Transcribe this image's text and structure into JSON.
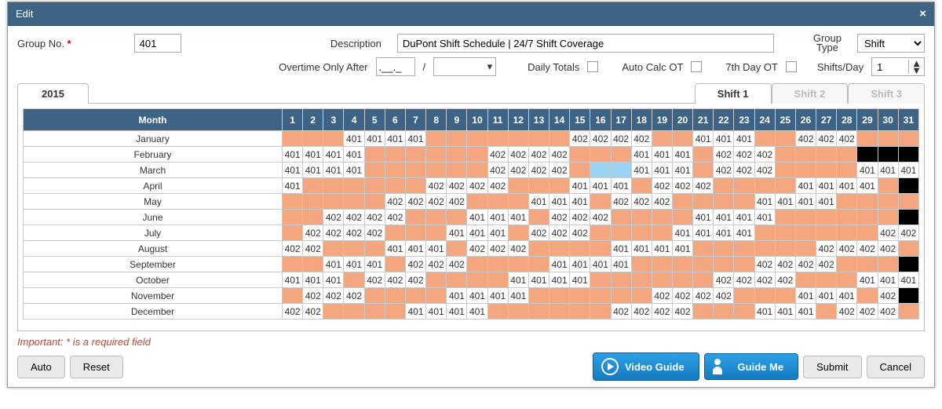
{
  "title": "Edit",
  "groupno_label": "Group No.",
  "groupno_value": "401",
  "desc_label": "Description",
  "desc_value": "DuPont Shift Schedule | 24/7 Shift Coverage",
  "grouptype_label": "Group Type",
  "grouptype_value": "Shift",
  "ot_after_label": "Overtime Only After",
  "ot_after_value": ".__._",
  "slash": "/",
  "daily_totals_label": "Daily Totals",
  "auto_calc_label": "Auto Calc OT",
  "seventh_day_label": "7th Day OT",
  "shifts_day_label": "Shifts/Day",
  "shifts_day_value": "1",
  "year_tab": "2015",
  "shift_tabs": [
    "Shift 1",
    "Shift 2",
    "Shift 3"
  ],
  "month_header": "Month",
  "days": [
    "1",
    "2",
    "3",
    "4",
    "5",
    "6",
    "7",
    "8",
    "9",
    "10",
    "11",
    "12",
    "13",
    "14",
    "15",
    "16",
    "17",
    "18",
    "19",
    "20",
    "21",
    "22",
    "23",
    "24",
    "25",
    "26",
    "27",
    "28",
    "29",
    "30",
    "31"
  ],
  "months": [
    "January",
    "February",
    "March",
    "April",
    "May",
    "June",
    "July",
    "August",
    "September",
    "October",
    "November",
    "December"
  ],
  "cells": {
    "January": [
      "p",
      "p",
      "p",
      "401",
      "401",
      "401",
      "401",
      "p",
      "p",
      "p",
      "p",
      "p",
      "p",
      "p",
      "402",
      "402",
      "402",
      "402",
      "p",
      "p",
      "401",
      "401",
      "401",
      "p",
      "p",
      "402",
      "402",
      "402",
      "p",
      "p",
      "p"
    ],
    "February": [
      "401",
      "401",
      "401",
      "401",
      "p",
      "p",
      "p",
      "p",
      "p",
      "p",
      "402",
      "402",
      "402",
      "402",
      "p",
      "p",
      "p",
      "401",
      "401",
      "401",
      "p",
      "402",
      "402",
      "402",
      "p",
      "p",
      "p",
      "p",
      "bk",
      "bk",
      "bk"
    ],
    "March": [
      "401",
      "401",
      "401",
      "401",
      "p",
      "p",
      "p",
      "p",
      "p",
      "p",
      "402",
      "402",
      "402",
      "402",
      "p",
      "b",
      "b",
      "401",
      "401",
      "401",
      "p",
      "402",
      "402",
      "402",
      "p",
      "p",
      "p",
      "p",
      "401",
      "401",
      "401"
    ],
    "April": [
      "401",
      "p",
      "p",
      "p",
      "p",
      "p",
      "p",
      "402",
      "402",
      "402",
      "402",
      "p",
      "p",
      "p",
      "401",
      "401",
      "401",
      "p",
      "402",
      "402",
      "402",
      "p",
      "p",
      "p",
      "p",
      "401",
      "401",
      "401",
      "401",
      "p",
      "bk"
    ],
    "May": [
      "p",
      "p",
      "p",
      "p",
      "p",
      "402",
      "402",
      "402",
      "402",
      "p",
      "p",
      "p",
      "401",
      "401",
      "401",
      "p",
      "402",
      "402",
      "402",
      "p",
      "p",
      "p",
      "p",
      "401",
      "401",
      "401",
      "401",
      "p",
      "p",
      "p",
      "p"
    ],
    "June": [
      "p",
      "p",
      "402",
      "402",
      "402",
      "402",
      "p",
      "p",
      "p",
      "401",
      "401",
      "401",
      "p",
      "402",
      "402",
      "402",
      "p",
      "p",
      "p",
      "p",
      "401",
      "401",
      "401",
      "401",
      "p",
      "p",
      "p",
      "p",
      "p",
      "p",
      "bk"
    ],
    "July": [
      "p",
      "402",
      "402",
      "402",
      "402",
      "p",
      "p",
      "p",
      "401",
      "401",
      "401",
      "p",
      "402",
      "402",
      "402",
      "p",
      "p",
      "p",
      "p",
      "401",
      "401",
      "401",
      "401",
      "p",
      "p",
      "p",
      "p",
      "p",
      "p",
      "402",
      "402"
    ],
    "August": [
      "402",
      "402",
      "p",
      "p",
      "p",
      "401",
      "401",
      "401",
      "p",
      "402",
      "402",
      "402",
      "p",
      "p",
      "p",
      "p",
      "401",
      "401",
      "401",
      "401",
      "p",
      "p",
      "p",
      "p",
      "p",
      "p",
      "402",
      "402",
      "402",
      "402",
      "p"
    ],
    "September": [
      "p",
      "p",
      "401",
      "401",
      "401",
      "p",
      "402",
      "402",
      "402",
      "p",
      "p",
      "p",
      "p",
      "401",
      "401",
      "401",
      "401",
      "p",
      "p",
      "p",
      "p",
      "p",
      "p",
      "402",
      "402",
      "402",
      "402",
      "p",
      "p",
      "p",
      "bk"
    ],
    "October": [
      "401",
      "401",
      "401",
      "p",
      "402",
      "402",
      "402",
      "p",
      "p",
      "p",
      "p",
      "401",
      "401",
      "401",
      "401",
      "p",
      "p",
      "p",
      "p",
      "p",
      "p",
      "402",
      "402",
      "402",
      "402",
      "p",
      "p",
      "p",
      "401",
      "401",
      "401"
    ],
    "November": [
      "p",
      "402",
      "402",
      "402",
      "p",
      "p",
      "p",
      "p",
      "401",
      "401",
      "401",
      "401",
      "p",
      "p",
      "p",
      "p",
      "p",
      "p",
      "402",
      "402",
      "402",
      "402",
      "p",
      "p",
      "p",
      "401",
      "401",
      "401",
      "p",
      "402",
      "bk"
    ],
    "December": [
      "402",
      "402",
      "p",
      "p",
      "p",
      "p",
      "401",
      "401",
      "401",
      "401",
      "p",
      "p",
      "p",
      "p",
      "p",
      "p",
      "402",
      "402",
      "402",
      "402",
      "p",
      "p",
      "p",
      "401",
      "401",
      "401",
      "p",
      "402",
      "402",
      "402",
      "p"
    ]
  },
  "note": "Important: * is a required field",
  "buttons": {
    "auto": "Auto",
    "reset": "Reset",
    "video": "Video Guide",
    "guide": "Guide Me",
    "submit": "Submit",
    "cancel": "Cancel"
  }
}
